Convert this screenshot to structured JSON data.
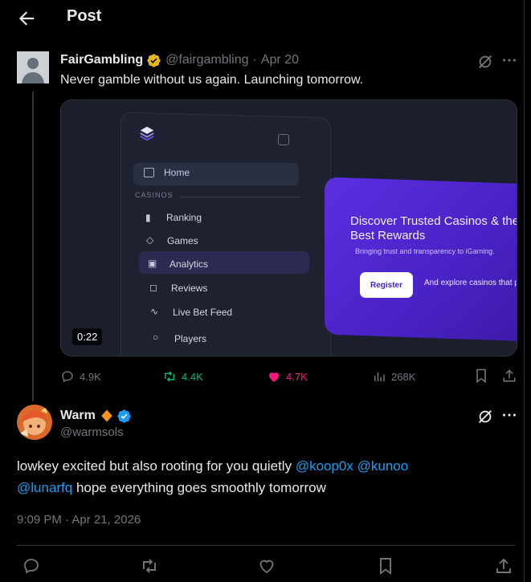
{
  "header": {
    "title": "Post"
  },
  "parent_post": {
    "author_name": "FairGambling",
    "handle": "@fairgambling",
    "date": "Apr 20",
    "text": "Never gamble without us again. Launching tomorrow.",
    "video_duration": "0:22",
    "media": {
      "menu": {
        "home": "Home",
        "section": "CASINOS",
        "items": [
          "Ranking",
          "Games",
          "Analytics",
          "Reviews",
          "Live Bet Feed",
          "Players"
        ]
      },
      "promo": {
        "title": "Discover Trusted Casinos & the Best Rewards",
        "subtitle": "Bringing trust and transparency to iGaming.",
        "button": "Register",
        "note": "And explore casinos that p"
      }
    },
    "stats": {
      "replies": "4.9K",
      "reposts": "4.4K",
      "likes": "4.7K",
      "views": "268K"
    }
  },
  "reply": {
    "author_name": "Warm",
    "handle": "@warmsols",
    "text_before": "lowkey excited but also rooting for you quietly ",
    "mentions": [
      "@koop0x",
      "@kunoo",
      "@lunarfq"
    ],
    "text_after": " hope everything goes smoothly tomorrow",
    "timestamp": "9:09 PM · Apr 21, 2026"
  },
  "colors": {
    "background": "#000000",
    "text": "#e7e9ea",
    "muted": "#71767b",
    "link": "#1d9bf0",
    "repost": "#00ba7c",
    "like": "#f91880",
    "gold_badge": "#e2b719",
    "blue_badge": "#1d9bf0"
  }
}
